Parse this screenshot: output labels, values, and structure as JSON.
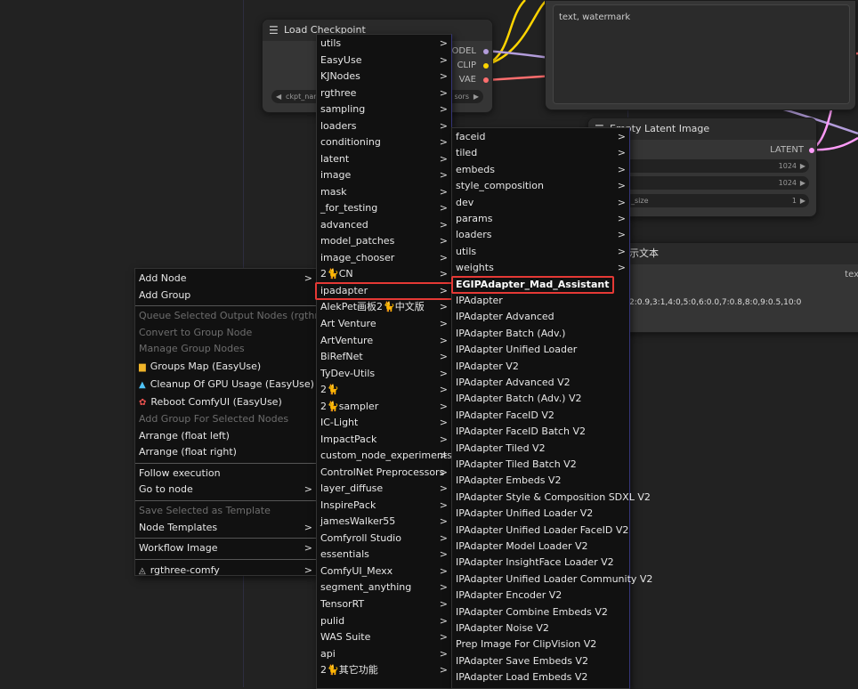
{
  "background_nodes": {
    "load_checkpoint": {
      "title": "Load Checkpoint",
      "outputs": [
        "MODEL",
        "CLIP",
        "VAE"
      ],
      "widget_left": "ckpt_nam",
      "widget_right": "sors"
    },
    "prompt_text": "text, watermark",
    "empty_latent": {
      "title": "Empty Latent Image",
      "output": "LATENT",
      "width": "1024",
      "height": "1024",
      "batch_label": "_size",
      "batch_value": "1"
    },
    "show_text": {
      "title": "示文本",
      "right_label": "tex",
      "content": "2:0.9,3:1,4:0,5:0,6:0.0,7:0.8,8:0,9:0.5,10:0"
    }
  },
  "context_menu": {
    "items": [
      {
        "label": "Add Node",
        "submenu": true
      },
      {
        "label": "Add Group"
      },
      {
        "sep": true
      },
      {
        "label": "Queue Selected Output Nodes (rgthree)",
        "disabled": true
      },
      {
        "label": "Convert to Group Node",
        "disabled": true
      },
      {
        "label": "Manage Group Nodes",
        "disabled": true
      },
      {
        "label": "Groups Map (EasyUse)",
        "icon": "groups-map-icon"
      },
      {
        "label": "Cleanup Of GPU Usage (EasyUse)",
        "icon": "rocket-icon"
      },
      {
        "label": "Reboot ComfyUI (EasyUse)",
        "icon": "reboot-icon"
      },
      {
        "label": "Add Group For Selected Nodes",
        "disabled": true
      },
      {
        "label": "Arrange (float left)"
      },
      {
        "label": "Arrange (float right)"
      },
      {
        "sep": true
      },
      {
        "label": "Follow execution"
      },
      {
        "label": "Go to node",
        "submenu": true
      },
      {
        "sep": true
      },
      {
        "label": "Save Selected as Template",
        "disabled": true
      },
      {
        "label": "Node Templates",
        "submenu": true
      },
      {
        "sep": true
      },
      {
        "label": "Workflow Image",
        "submenu": true
      },
      {
        "sep": true
      },
      {
        "label": "rgthree-comfy",
        "submenu": true,
        "icon": "rgthree-icon"
      }
    ]
  },
  "category_menu": {
    "items": [
      "utils",
      "EasyUse",
      "KJNodes",
      "rgthree",
      "sampling",
      "loaders",
      "conditioning",
      "latent",
      "image",
      "mask",
      "_for_testing",
      "advanced",
      "model_patches",
      "image_chooser",
      "2🐈CN",
      "ipadapter",
      "AlekPet画板2🐈中文版",
      "Art Venture",
      "ArtVenture",
      "BiRefNet",
      "TyDev-Utils",
      "2🐈",
      "2🐈sampler",
      "IC-Light",
      "ImpactPack",
      "custom_node_experiments",
      "ControlNet Preprocessors",
      "layer_diffuse",
      "InspirePack",
      "jamesWalker55",
      "Comfyroll Studio",
      "essentials",
      "ComfyUI_Mexx",
      "segment_anything",
      "TensorRT",
      "pulid",
      "WAS Suite",
      "api",
      "2🐈其它功能"
    ],
    "highlighted": "ipadapter"
  },
  "ipadapter_menu": {
    "submenus": [
      "faceid",
      "tiled",
      "embeds",
      "style_composition",
      "dev",
      "params",
      "loaders",
      "utils",
      "weights"
    ],
    "nodes": [
      "EGIPAdapter_Mad_Assistant",
      "IPAdapter",
      "IPAdapter Advanced",
      "IPAdapter Batch (Adv.)",
      "IPAdapter Unified Loader",
      "IPAdapter V2",
      "IPAdapter Advanced V2",
      "IPAdapter Batch (Adv.) V2",
      "IPAdapter FaceID V2",
      "IPAdapter FaceID Batch V2",
      "IPAdapter Tiled V2",
      "IPAdapter Tiled Batch V2",
      "IPAdapter Embeds V2",
      "IPAdapter Style & Composition SDXL V2",
      "IPAdapter Unified Loader V2",
      "IPAdapter Unified Loader FaceID V2",
      "IPAdapter Model Loader V2",
      "IPAdapter InsightFace Loader V2",
      "IPAdapter Unified Loader Community V2",
      "IPAdapter Encoder V2",
      "IPAdapter Combine Embeds V2",
      "IPAdapter Noise V2",
      "Prep Image For ClipVision V2",
      "IPAdapter Save Embeds V2",
      "IPAdapter Load Embeds V2"
    ],
    "highlighted": "EGIPAdapter_Mad_Assistant"
  },
  "colors": {
    "canvas": "#222222",
    "menu_bg": "#111111",
    "highlight_border": "#e53935",
    "model_link": "#b39ddb",
    "clip_link": "#ffd500",
    "vae_link": "#ff6e6e",
    "latent_link": "#ff9cf9"
  }
}
